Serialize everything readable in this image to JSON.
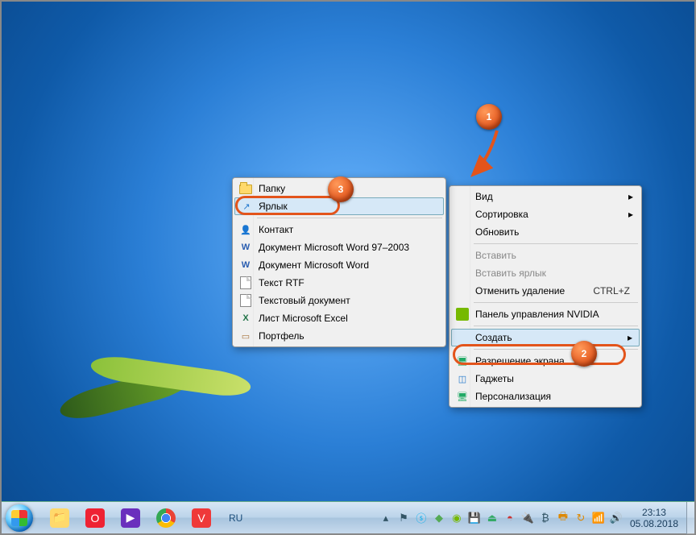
{
  "callouts": [
    "1",
    "2",
    "3"
  ],
  "context_menu": {
    "items": [
      {
        "label": "Вид",
        "submenu": true
      },
      {
        "label": "Сортировка",
        "submenu": true
      },
      {
        "label": "Обновить"
      },
      {
        "label": "Вставить",
        "disabled": true
      },
      {
        "label": "Вставить ярлык",
        "disabled": true
      },
      {
        "label": "Отменить удаление",
        "hotkey": "CTRL+Z"
      },
      {
        "label": "Панель управления NVIDIA",
        "icon": "nvidia"
      },
      {
        "label": "Создать",
        "submenu": true,
        "highlighted": true
      },
      {
        "label": "Разрешение экрана",
        "icon": "monitor"
      },
      {
        "label": "Гаджеты",
        "icon": "gadget"
      },
      {
        "label": "Персонализация",
        "icon": "personalize"
      }
    ]
  },
  "submenu_new": {
    "items": [
      {
        "label": "Папку",
        "icon": "folder"
      },
      {
        "label": "Ярлык",
        "icon": "shortcut",
        "highlighted": true
      },
      {
        "label": "Контакт",
        "icon": "contact"
      },
      {
        "label": "Документ Microsoft Word 97–2003",
        "icon": "word"
      },
      {
        "label": "Документ Microsoft Word",
        "icon": "word"
      },
      {
        "label": "Текст RTF",
        "icon": "document"
      },
      {
        "label": "Текстовый документ",
        "icon": "document"
      },
      {
        "label": "Лист Microsoft Excel",
        "icon": "excel"
      },
      {
        "label": "Портфель",
        "icon": "briefcase"
      }
    ]
  },
  "taskbar": {
    "language": "RU",
    "time": "23:13",
    "date": "05.08.2018",
    "pinned": [
      "explorer",
      "opera",
      "player",
      "chrome",
      "vivaldi"
    ]
  }
}
